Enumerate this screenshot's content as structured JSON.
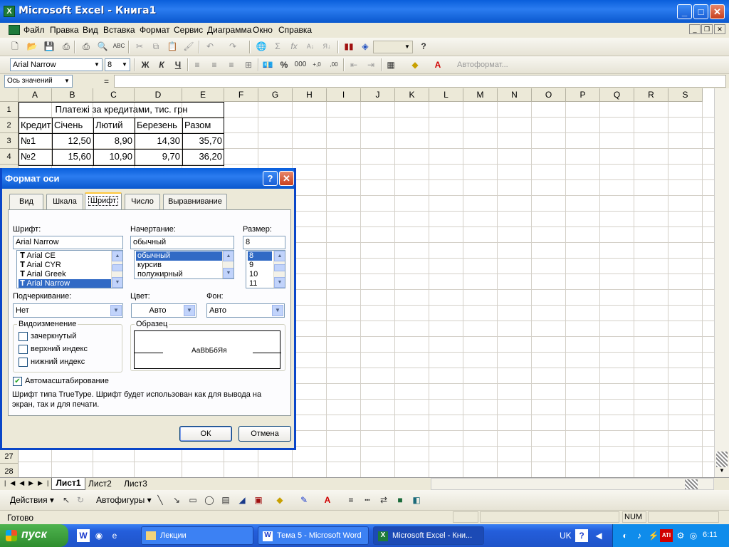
{
  "window": {
    "title": "Microsoft Excel - Книга1"
  },
  "menu": [
    "Файл",
    "Правка",
    "Вид",
    "Вставка",
    "Формат",
    "Сервис",
    "Диаграмма",
    "Окно",
    "Справка"
  ],
  "format_toolbar": {
    "font": "Arial Narrow",
    "size": "8",
    "bold": "Ж",
    "italic": "К",
    "underline": "Ч",
    "percent": "%",
    "thousands": "000",
    "autoformat": "Автоформат..."
  },
  "formula_bar": {
    "name_box": "Ось значений",
    "eq": "="
  },
  "columns": [
    "A",
    "B",
    "C",
    "D",
    "E",
    "F",
    "G",
    "H",
    "I",
    "J",
    "K",
    "L",
    "M",
    "N",
    "O",
    "P",
    "Q",
    "R",
    "S"
  ],
  "rows_top": [
    "1",
    "2",
    "3",
    "4"
  ],
  "rows_bottom": [
    "27",
    "28"
  ],
  "sheet": {
    "title": "Платежі за кредитами, тис. грн",
    "header": [
      "Кредит",
      "Січень",
      "Лютий",
      "Березень",
      "Разом"
    ],
    "r3": [
      "№1",
      "12,50",
      "8,90",
      "14,30",
      "35,70"
    ],
    "r4": [
      "№2",
      "15,60",
      "10,90",
      "9,70",
      "36,20"
    ]
  },
  "sheet_tabs": [
    "Лист1",
    "Лист2",
    "Лист3"
  ],
  "draw_toolbar": {
    "actions": "Действия",
    "autoshapes": "Автофигуры"
  },
  "status": {
    "ready": "Готово",
    "num": "NUM"
  },
  "taskbar": {
    "start": "пуск",
    "tasks": [
      "Лекции",
      "Тема 5 - Microsoft Word",
      "Microsoft Excel - Кни..."
    ],
    "lang": "UK",
    "clock": "6:11"
  },
  "dialog": {
    "title": "Формат оси",
    "tabs": [
      "Вид",
      "Шкала",
      "Шрифт",
      "Число",
      "Выравнивание"
    ],
    "font_label": "Шрифт:",
    "font_value": "Arial Narrow",
    "font_list": [
      "Arial CE",
      "Arial CYR",
      "Arial Greek",
      "Arial Narrow"
    ],
    "style_label": "Начертание:",
    "style_value": "обычный",
    "style_list": [
      "обычный",
      "курсив",
      "полужирный"
    ],
    "size_label": "Размер:",
    "size_value": "8",
    "size_list": [
      "8",
      "9",
      "10",
      "11"
    ],
    "underline_label": "Подчеркивание:",
    "underline_value": "Нет",
    "color_label": "Цвет:",
    "color_value": "Авто",
    "bg_label": "Фон:",
    "bg_value": "Авто",
    "effects_label": "Видоизменение",
    "effects": [
      "зачеркнутый",
      "верхний индекс",
      "нижний индекс"
    ],
    "sample_label": "Образец",
    "sample_text": "АаВbБбЯя",
    "autoscale": "Автомасштабирование",
    "note": "Шрифт типа TrueType. Шрифт будет использован как для вывода на экран, так и для печати.",
    "ok": "ОК",
    "cancel": "Отмена"
  }
}
